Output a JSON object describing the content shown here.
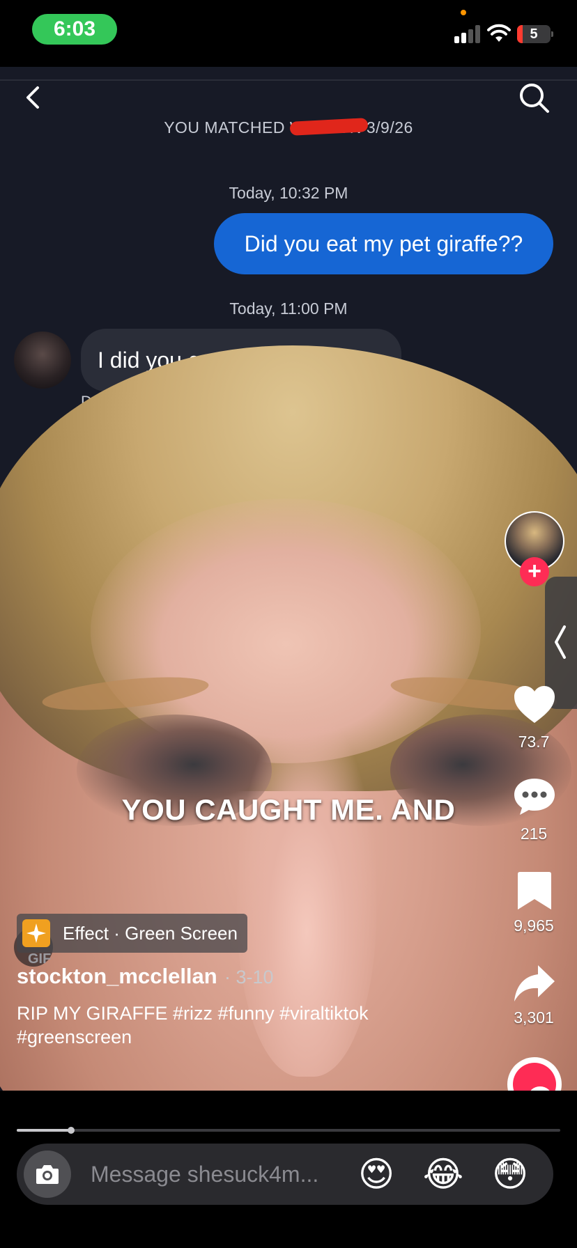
{
  "status_bar": {
    "time": "6:03",
    "battery": "5"
  },
  "chat": {
    "matched_text": "YOU MATCHED WITH                ON 3/9/26",
    "timestamp_1": "Today, 10:32 PM",
    "outgoing_message": "Did you eat my pet giraffe??",
    "timestamp_2": "Today, 11:00 PM",
    "incoming_message": "I did you caught me 😭😭",
    "hint": "Double"
  },
  "video": {
    "caption": "YOU CAUGHT ME. AND"
  },
  "rail": {
    "likes": "73.7",
    "comments": "215",
    "saves": "9,965",
    "shares": "3,301"
  },
  "info": {
    "effect": "Effect · Green Screen",
    "gif": "GIF",
    "username": "stockton_mcclellan",
    "date": "· 3-10",
    "description": "RIP MY GIRAFFE #rizz #funny #viraltiktok #greenscreen"
  },
  "progress": {
    "fraction": 0.1
  },
  "message_bar": {
    "placeholder": "Message shesuck4m...",
    "emojis": [
      "😍",
      "😂",
      "😳"
    ]
  },
  "colors": {
    "accent": "#fe2c55",
    "bubble_out": "#1666d4",
    "time_pill": "#34c759"
  }
}
